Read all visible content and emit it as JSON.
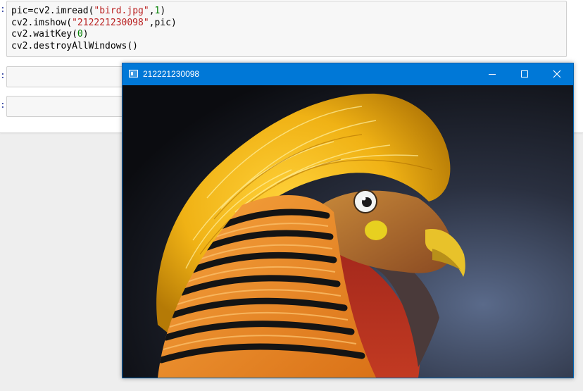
{
  "notebook": {
    "cells": [
      {
        "prompt": ":",
        "code_lines": [
          [
            {
              "t": "pic=cv2.imread(",
              "c": ""
            },
            {
              "t": "\"bird.jpg\"",
              "c": "str"
            },
            {
              "t": ",",
              "c": ""
            },
            {
              "t": "1",
              "c": "num"
            },
            {
              "t": ")",
              "c": ""
            }
          ],
          [
            {
              "t": "cv2.imshow(",
              "c": ""
            },
            {
              "t": "\"212221230098\"",
              "c": "str"
            },
            {
              "t": ",pic)",
              "c": ""
            }
          ],
          [
            {
              "t": "cv2.waitKey(",
              "c": ""
            },
            {
              "t": "0",
              "c": "num"
            },
            {
              "t": ")",
              "c": ""
            }
          ],
          [
            {
              "t": "cv2.destroyAllWindows()",
              "c": ""
            }
          ]
        ]
      },
      {
        "prompt": ":",
        "code_lines": []
      },
      {
        "prompt": ":",
        "code_lines": []
      }
    ]
  },
  "cv_window": {
    "title": "212221230098",
    "titlebar_color": "#0078d7",
    "buttons": {
      "minimize": "minimize-icon",
      "maximize": "maximize-icon",
      "close": "close-icon"
    },
    "image": {
      "file": "bird.jpg",
      "subject": "golden-pheasant"
    }
  }
}
